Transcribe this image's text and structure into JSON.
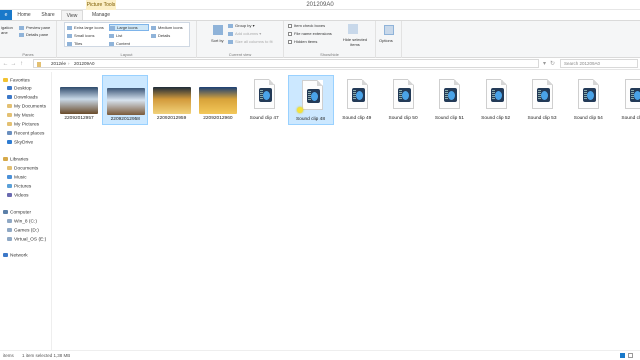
{
  "window": {
    "title": "201209A0",
    "contextual_tab": "Picture Tools"
  },
  "tabs": {
    "file": "e",
    "home": "Home",
    "share": "Share",
    "view": "View",
    "manage": "Manage"
  },
  "ribbon": {
    "panes": {
      "navigation_pane": "igation\nane",
      "preview_pane": "Preview pane",
      "details_pane": "Details pane",
      "label": "Panes"
    },
    "layout": {
      "extra_large_icons": "Extra large icons",
      "large_icons": "Large icons",
      "medium_icons": "Medium icons",
      "small_icons": "Small icons",
      "list": "List",
      "details": "Details",
      "tiles": "Tiles",
      "content": "Content",
      "label": "Layout"
    },
    "current_view": {
      "sort_by": "Sort by",
      "group_by": "Group by",
      "add_columns": "Add columns",
      "size_all_columns": "Size all columns to fit",
      "label": "Current view"
    },
    "show_hide": {
      "item_check_boxes": "Item check boxes",
      "file_name_extensions": "File name extensions",
      "hidden_items": "Hidden items",
      "hide_selected_items": "Hide selected items",
      "label": "Show/hide"
    },
    "options": "Options"
  },
  "address": {
    "crumbs": [
      "2012ée",
      "201209A0"
    ],
    "search_placeholder": "Search 201209A0"
  },
  "nav": {
    "favorites": "Favorites",
    "favorites_items": [
      "Desktop",
      "Downloads",
      "My Documents",
      "My Music",
      "My Pictures",
      "Recent places",
      "SkyDrive"
    ],
    "libraries": "Libraries",
    "libraries_items": [
      "Documents",
      "Music",
      "Pictures",
      "Videos"
    ],
    "computer": "Computer",
    "computer_items": [
      "Win_8 (C:)",
      "Games (D:)",
      "Virtual_OS (E:)"
    ],
    "network": "Network"
  },
  "files": [
    {
      "name": "22092012957",
      "kind": "photo",
      "colors": [
        "#2e4a6b",
        "#c9d9e8",
        "#6a4b2a"
      ]
    },
    {
      "name": "22092012958",
      "kind": "photo",
      "selected": true,
      "colors": [
        "#3b5677",
        "#d7e3ef",
        "#7b5a3a"
      ]
    },
    {
      "name": "22092012959",
      "kind": "photo",
      "colors": [
        "#1e2b3a",
        "#d29a3b",
        "#f1d27a"
      ]
    },
    {
      "name": "22092012960",
      "kind": "photo",
      "colors": [
        "#1b3f74",
        "#d8a33a",
        "#f3c85a"
      ]
    },
    {
      "name": "Sound clip 47",
      "kind": "audio"
    },
    {
      "name": "Sound clip 48",
      "kind": "audio",
      "selected": true
    },
    {
      "name": "Sound clip 49",
      "kind": "audio"
    },
    {
      "name": "Sound clip 50",
      "kind": "audio"
    },
    {
      "name": "Sound clip 51",
      "kind": "audio"
    },
    {
      "name": "Sound clip 52",
      "kind": "audio"
    },
    {
      "name": "Sound clip 53",
      "kind": "audio"
    },
    {
      "name": "Sound clip 54",
      "kind": "audio"
    },
    {
      "name": "Sound clip 5",
      "kind": "audio"
    }
  ],
  "status": {
    "items": "items",
    "selected": "1 item selected  1,38 MB"
  },
  "colors": {
    "accent": "#1979ca",
    "selection": "#cce8ff"
  }
}
